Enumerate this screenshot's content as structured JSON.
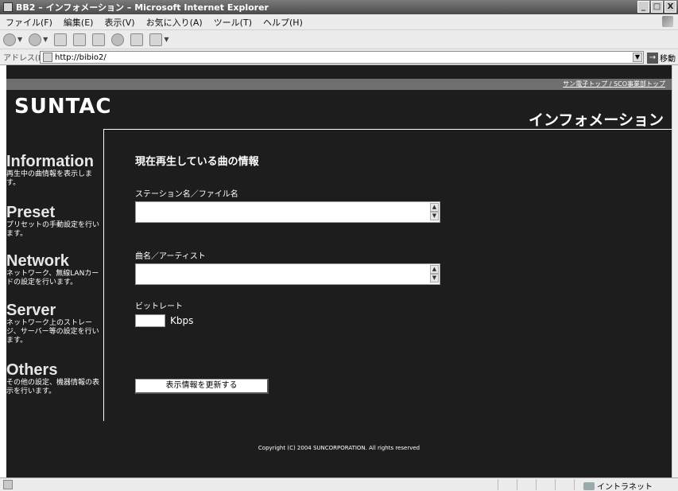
{
  "window": {
    "title": "BB2 – インフォメーション – Microsoft Internet Explorer",
    "controls": [
      "_",
      "□",
      "X"
    ]
  },
  "menu": [
    "ファイル(F)",
    "編集(E)",
    "表示(V)",
    "お気に入り(A)",
    "ツール(T)",
    "ヘルプ(H)"
  ],
  "address": {
    "label": "アドレス(D)",
    "url": "http://bibio2/",
    "go_label": "移動"
  },
  "page": {
    "top_links": "サン電子トップ / SCO事業部トップ",
    "logo": "SUNTAC",
    "heading": "インフォメーション",
    "nav": [
      {
        "title": "Information",
        "desc": "再生中の曲情報を表示します。"
      },
      {
        "title": "Preset",
        "desc": "プリセットの手動設定を行います。"
      },
      {
        "title": "Network",
        "desc": "ネットワーク、無線LANカードの設定を行います。"
      },
      {
        "title": "Server",
        "desc": "ネットワーク上のストレージ、サーバー等の設定を行います。"
      },
      {
        "title": "Others",
        "desc": "その他の設定、機器情報の表示を行います。"
      }
    ],
    "main_title": "現在再生している曲の情報",
    "station_label": "ステーション名／ファイル名",
    "station_value": "",
    "song_label": "曲名／アーティスト",
    "song_value": "",
    "bitrate_label": "ビットレート",
    "bitrate_value": "",
    "bitrate_unit": "Kbps",
    "refresh_button": "表示情報を更新する",
    "copyright": "Copyright (C) 2004 SUNCORPORATION. All rights reserved"
  },
  "status": {
    "zone": "イントラネット"
  }
}
